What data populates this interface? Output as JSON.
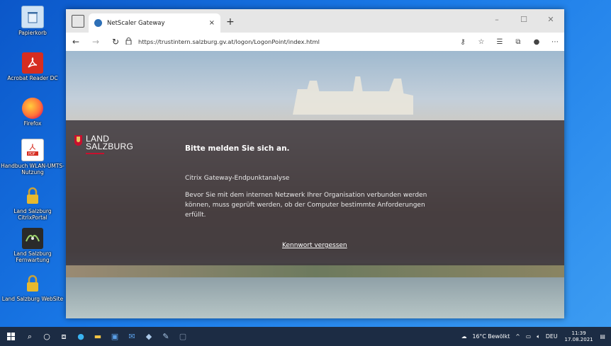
{
  "desktop": {
    "icons": [
      {
        "label": "Papierkorb",
        "icon": "recycle-bin-icon"
      },
      {
        "label": "Acrobat Reader DC",
        "icon": "acrobat-icon"
      },
      {
        "label": "Firefox",
        "icon": "firefox-icon"
      },
      {
        "label": "Handbuch WLAN-UMTS-Nutzung",
        "icon": "pdf-icon"
      },
      {
        "label": "Land Salzburg CitrixPortal",
        "icon": "lock-icon"
      },
      {
        "label": "Land Salzburg Fernwartung",
        "icon": "remote-icon"
      },
      {
        "label": "Land Salzburg WebSite",
        "icon": "lock-icon"
      }
    ]
  },
  "browser": {
    "tab_title": "NetScaler Gateway",
    "tab_close": "×",
    "new_tab": "+",
    "url": "https://trustintern.salzburg.gv.at/logon/LogonPoint/index.html",
    "window_controls": [
      "–",
      "☐",
      "✕"
    ]
  },
  "page": {
    "logo_line1": "LAND",
    "logo_line2": "SALZBURG",
    "heading": "Bitte melden Sie sich an.",
    "subheading": "Citrix Gateway-Endpunktanalyse",
    "paragraph": "Bevor Sie mit dem internen Netzwerk Ihrer Organisation verbunden werden können, muss geprüft werden, ob der Computer bestimmte Anforderungen erfüllt.",
    "forgot_link": "Kennwort vergessen"
  },
  "taskbar": {
    "weather": "16°C Bewölkt",
    "language": "DEU",
    "time": "11:39",
    "date": "17.08.2021"
  },
  "colors": {
    "accent_red": "#c8102e",
    "taskbar": "#1c2c44",
    "panel": "#3c373c"
  }
}
